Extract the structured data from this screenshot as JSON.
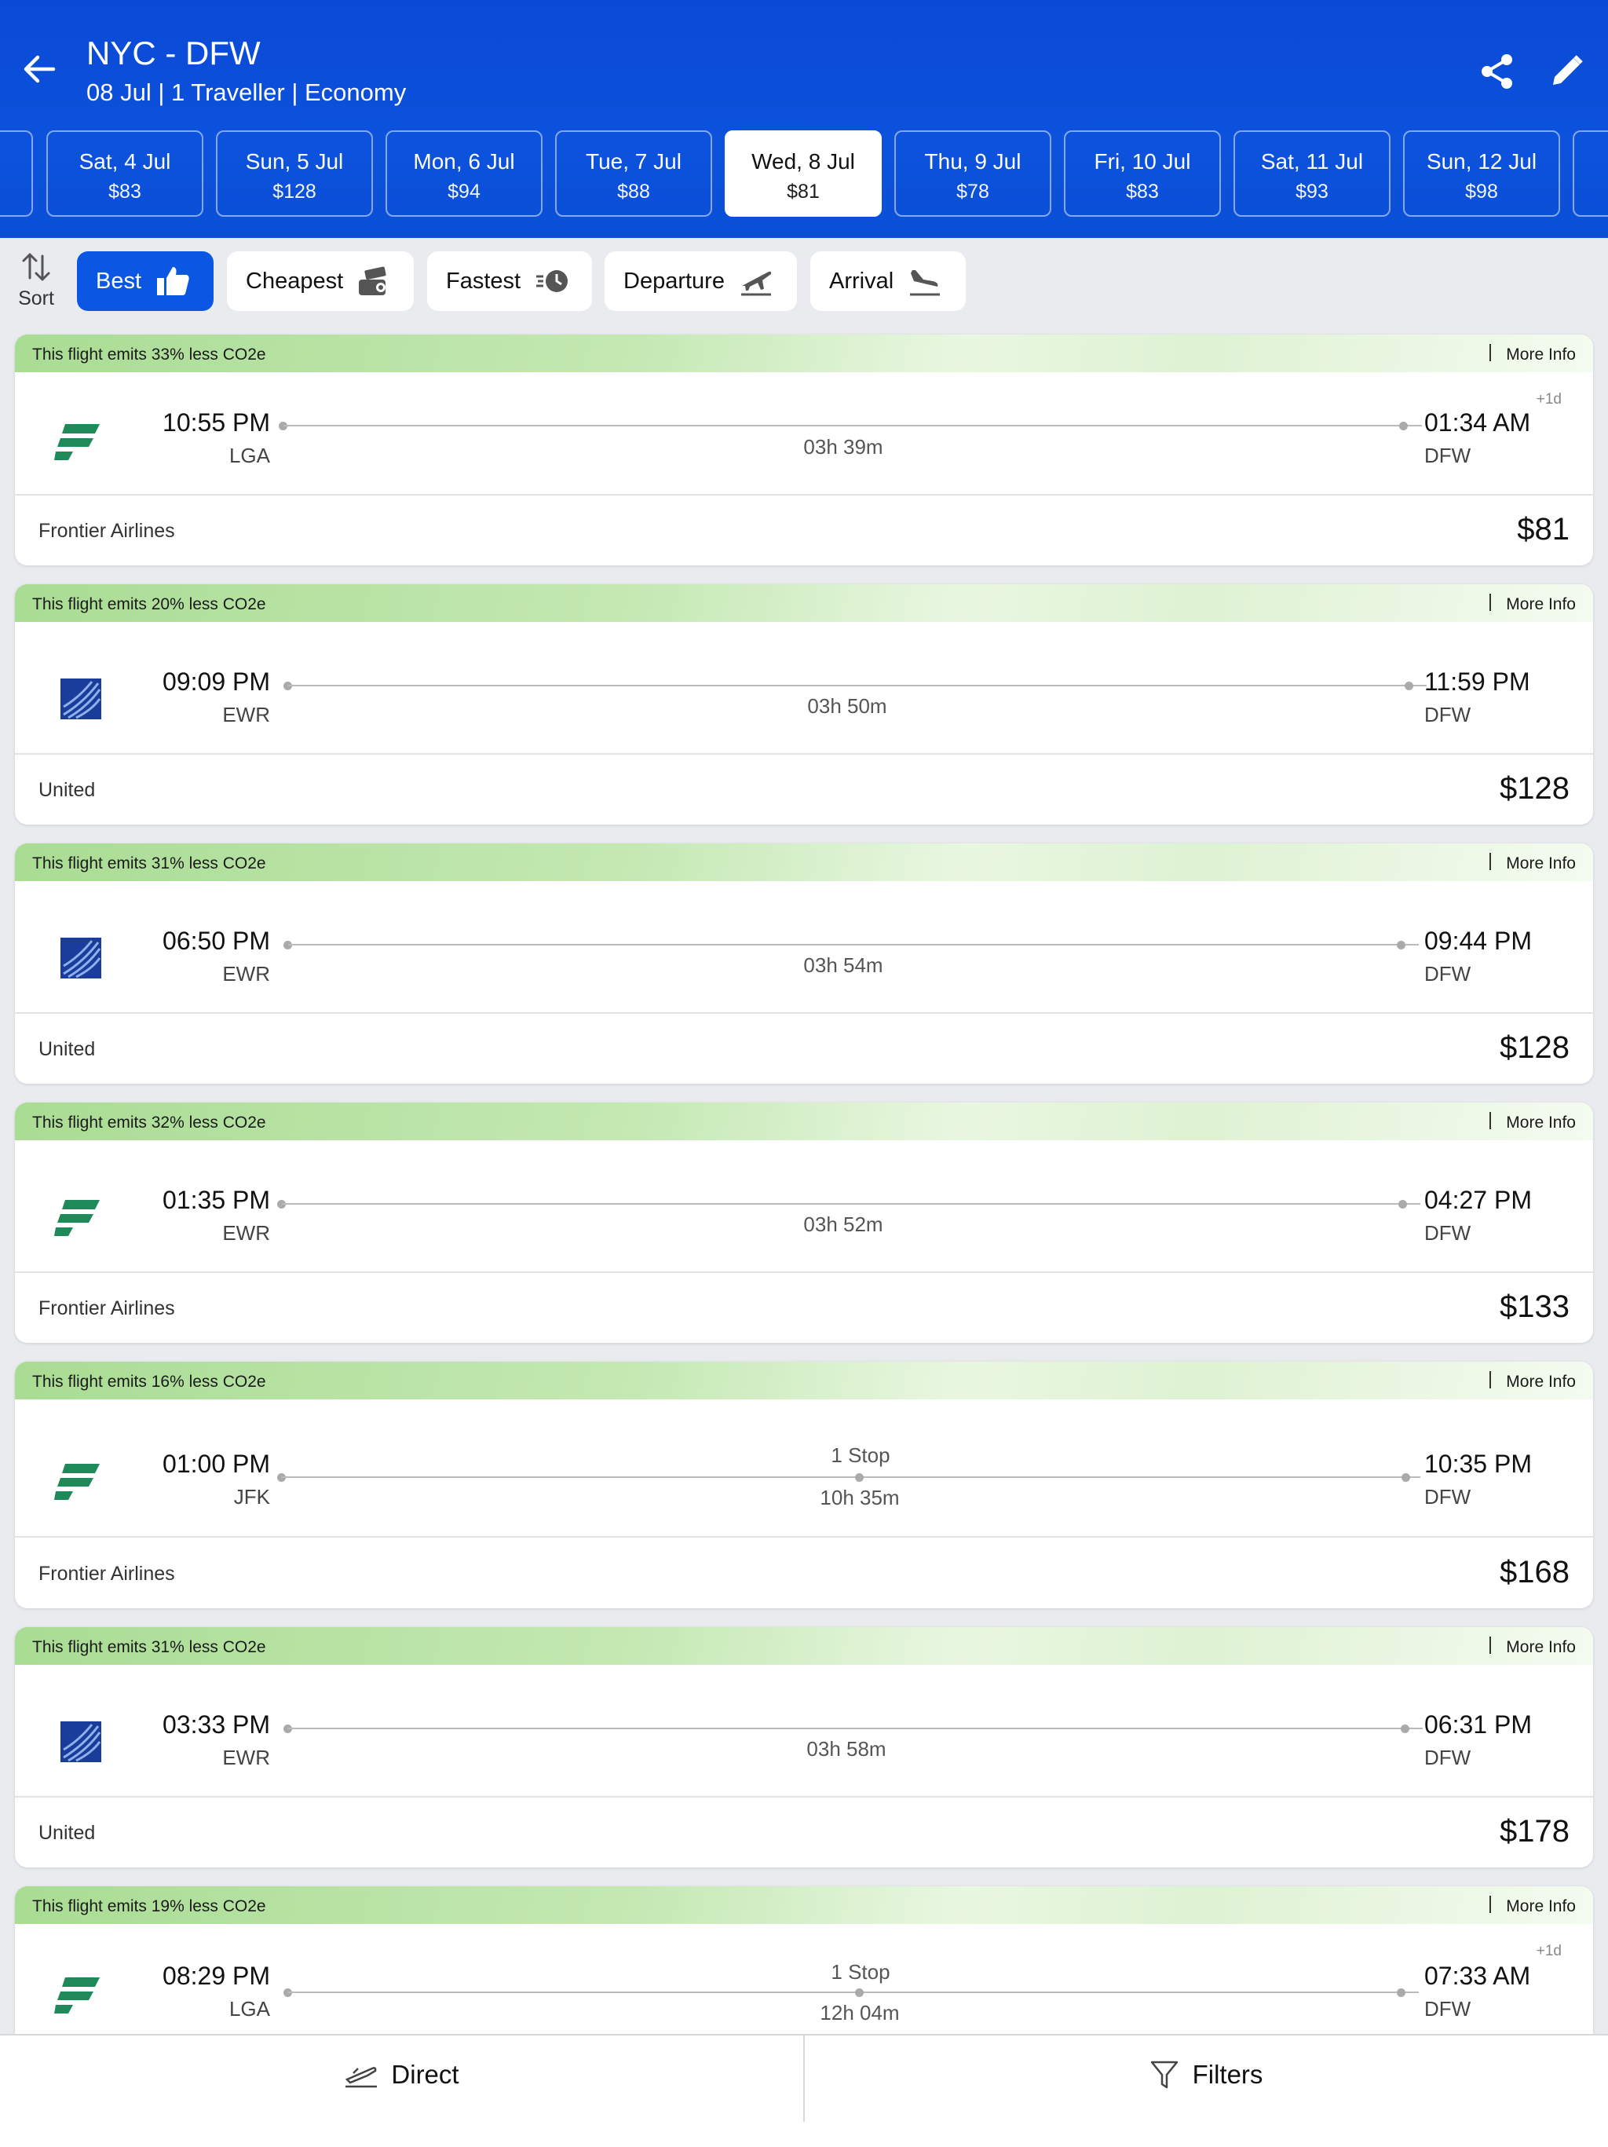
{
  "header": {
    "route": "NYC - DFW",
    "subtitle": "08 Jul | 1 Traveller | Economy"
  },
  "dates": [
    {
      "day": "Sat, 4 Jul",
      "price": "$83"
    },
    {
      "day": "Sun, 5 Jul",
      "price": "$128"
    },
    {
      "day": "Mon, 6 Jul",
      "price": "$94"
    },
    {
      "day": "Tue, 7 Jul",
      "price": "$88"
    },
    {
      "day": "Wed, 8 Jul",
      "price": "$81"
    },
    {
      "day": "Thu, 9 Jul",
      "price": "$78"
    },
    {
      "day": "Fri, 10 Jul",
      "price": "$83"
    },
    {
      "day": "Sat, 11 Jul",
      "price": "$93"
    },
    {
      "day": "Sun, 12 Jul",
      "price": "$98"
    }
  ],
  "sort": {
    "label": "Sort",
    "options": [
      "Best",
      "Cheapest",
      "Fastest",
      "Departure",
      "Arrival"
    ]
  },
  "flights": [
    {
      "co2": "This flight emits 33% less CO2e",
      "more": "More Info",
      "dep_time": "10:55 PM",
      "dep_code": "LGA",
      "arr_time": "01:34 AM",
      "arr_code": "DFW",
      "plus": "+1d",
      "duration": "03h 39m",
      "airline": "Frontier Airlines",
      "price": "$81"
    },
    {
      "co2": "This flight emits 20% less CO2e",
      "more": "More Info",
      "dep_time": "09:09 PM",
      "dep_code": "EWR",
      "arr_time": "11:59 PM",
      "arr_code": "DFW",
      "duration": "03h 50m",
      "airline": "United",
      "price": "$128"
    },
    {
      "co2": "This flight emits 31% less CO2e",
      "more": "More Info",
      "dep_time": "06:50 PM",
      "dep_code": "EWR",
      "arr_time": "09:44 PM",
      "arr_code": "DFW",
      "duration": "03h 54m",
      "airline": "United",
      "price": "$128"
    },
    {
      "co2": "This flight emits 32% less CO2e",
      "more": "More Info",
      "dep_time": "01:35 PM",
      "dep_code": "EWR",
      "arr_time": "04:27 PM",
      "arr_code": "DFW",
      "duration": "03h 52m",
      "airline": "Frontier Airlines",
      "price": "$133"
    },
    {
      "co2": "This flight emits 16% less CO2e",
      "more": "More Info",
      "dep_time": "01:00 PM",
      "dep_code": "JFK",
      "arr_time": "10:35 PM",
      "arr_code": "DFW",
      "stops": "1 Stop",
      "duration": "10h 35m",
      "airline": "Frontier Airlines",
      "price": "$168"
    },
    {
      "co2": "This flight emits 31% less CO2e",
      "more": "More Info",
      "dep_time": "03:33 PM",
      "dep_code": "EWR",
      "arr_time": "06:31 PM",
      "arr_code": "DFW",
      "duration": "03h 58m",
      "airline": "United",
      "price": "$178"
    },
    {
      "co2": "This flight emits 19% less CO2e",
      "more": "More Info",
      "dep_time": "08:29 PM",
      "dep_code": "LGA",
      "arr_time": "07:33 AM",
      "arr_code": "DFW",
      "plus": "+1d",
      "stops": "1 Stop",
      "duration": "12h 04m",
      "airline": "",
      "price": ""
    }
  ],
  "bottom": {
    "direct": "Direct",
    "filters": "Filters"
  }
}
